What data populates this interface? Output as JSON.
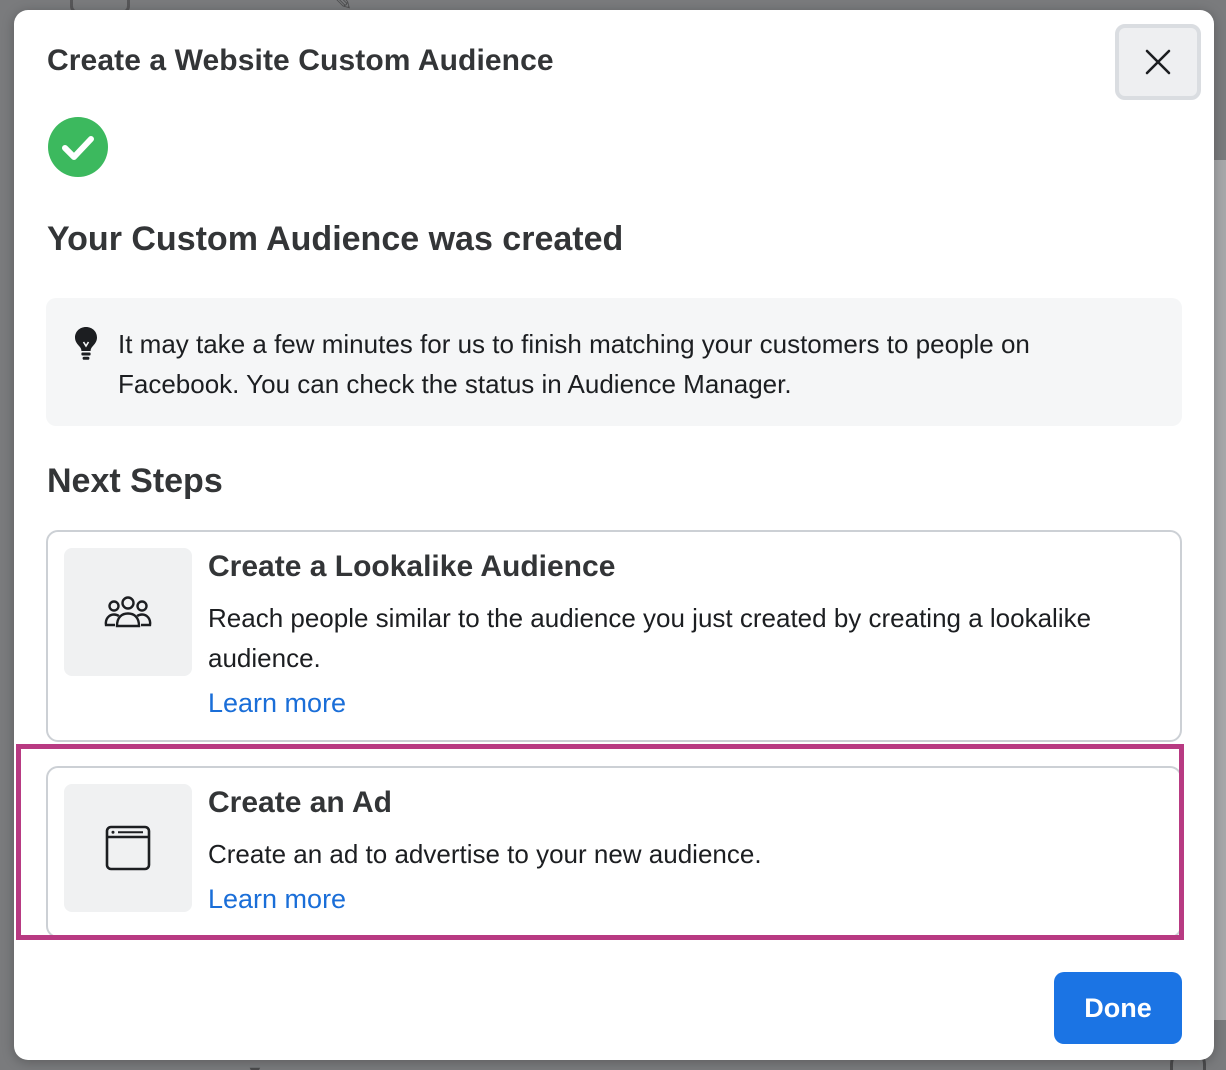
{
  "modal": {
    "title": "Create a Website Custom Audience",
    "success_heading": "Your Custom Audience was created",
    "info_text": "It may take a few minutes for us to finish matching your customers to people on Facebook. You can check the status in Audience Manager.",
    "next_steps_heading": "Next Steps",
    "done_label": "Done"
  },
  "steps": [
    {
      "title": "Create a Lookalike Audience",
      "description": "Reach people similar to the audience you just created by creating a lookalike audience.",
      "link": "Learn more",
      "icon": "people-group-icon"
    },
    {
      "title": "Create an Ad",
      "description": "Create an ad to advertise to your new audience.",
      "link": "Learn more",
      "icon": "browser-window-icon"
    }
  ],
  "colors": {
    "success_green": "#3cb95e",
    "link_blue": "#1a6ed8",
    "primary_button": "#1b74e4",
    "highlight": "#b83a82"
  }
}
